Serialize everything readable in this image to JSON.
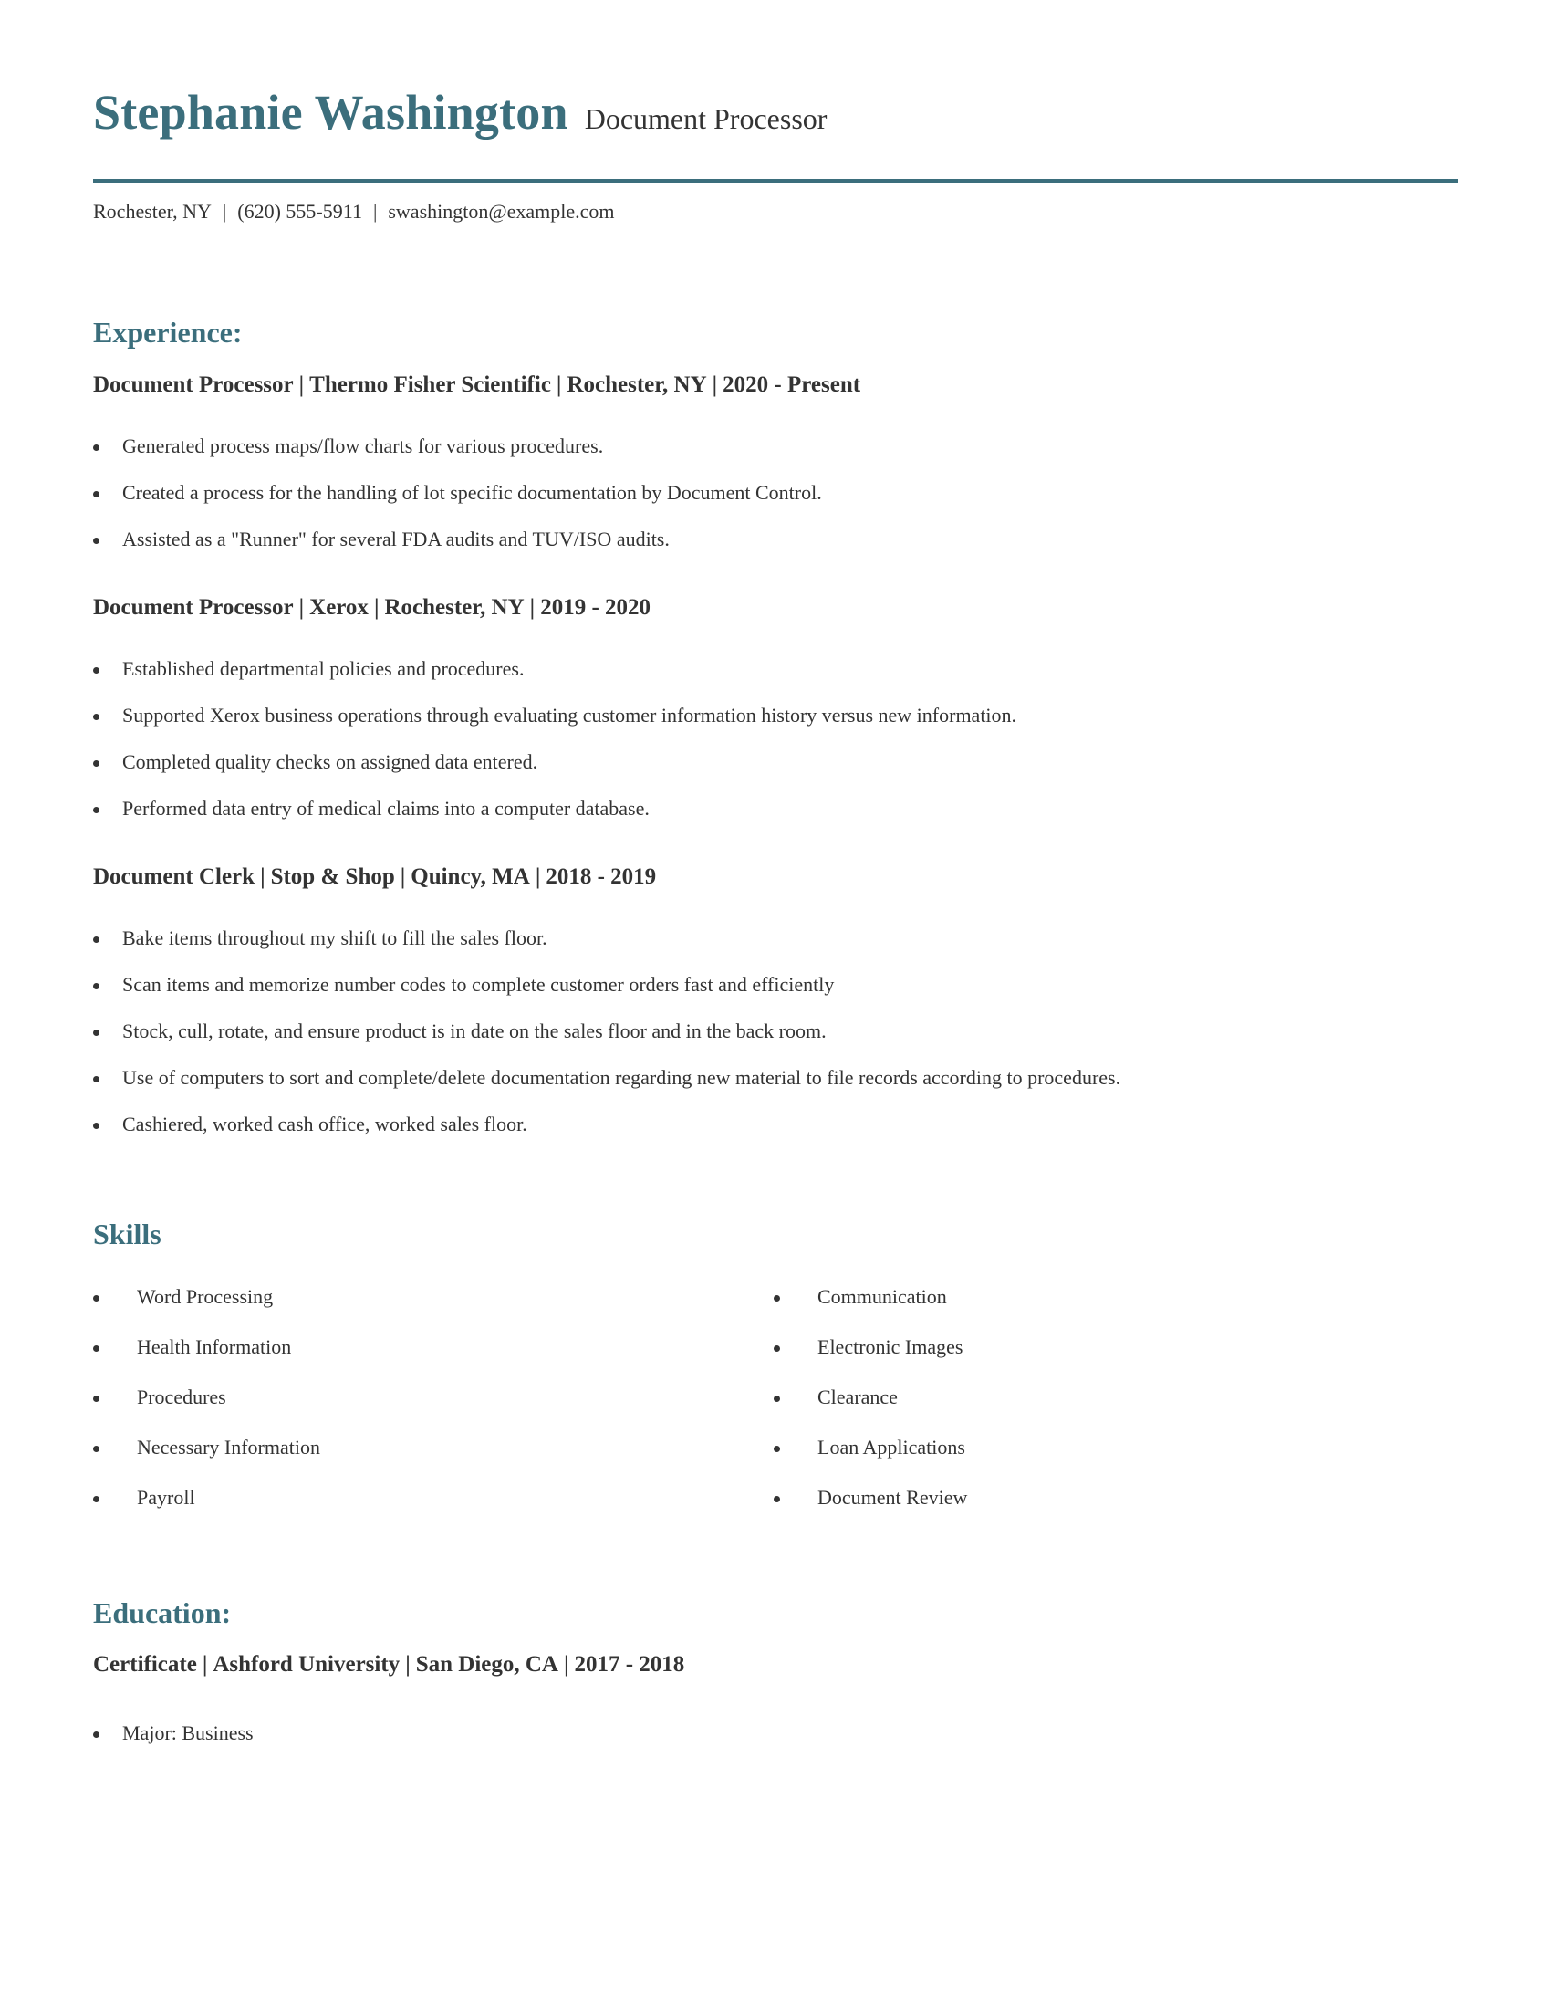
{
  "header": {
    "name": "Stephanie Washington",
    "role": "Document Processor",
    "contact": {
      "location": "Rochester, NY",
      "phone": "(620) 555-5911",
      "email": "swashington@example.com",
      "separator": "|"
    },
    "accent_color": "#3b6e7c"
  },
  "experience": {
    "title": "Experience:",
    "jobs": [
      {
        "role": "Document Processor",
        "company": "Thermo Fisher Scientific",
        "location": "Rochester, NY",
        "dates": "2020 - Present",
        "bullets": [
          "Generated process maps/flow charts for various procedures.",
          "Created a process for the handling of lot specific documentation by Document Control.",
          "Assisted as a \"Runner\" for several FDA audits and TUV/ISO audits."
        ]
      },
      {
        "role": "Document Processor",
        "company": "Xerox",
        "location": "Rochester, NY",
        "dates": "2019 - 2020",
        "bullets": [
          "Established departmental policies and procedures.",
          "Supported Xerox business operations through evaluating customer information history versus new information.",
          "Completed quality checks on assigned data entered.",
          "Performed data entry of medical claims into a computer database."
        ]
      },
      {
        "role": "Document Clerk",
        "company": "Stop & Shop",
        "location": "Quincy, MA",
        "dates": "2018 - 2019",
        "bullets": [
          "Bake items throughout my shift to fill the sales floor.",
          "Scan items and memorize number codes to complete customer orders fast and efficiently",
          "Stock, cull, rotate, and ensure product is in date on the sales floor and in the back room.",
          "Use of computers to sort and complete/delete documentation regarding new material to file records according to procedures.",
          "Cashiered, worked cash office, worked sales floor."
        ]
      }
    ]
  },
  "skills": {
    "title": "Skills",
    "left": [
      "Word Processing",
      "Health Information",
      "Procedures",
      "Necessary Information",
      "Payroll"
    ],
    "right": [
      "Communication",
      "Electronic Images",
      "Clearance",
      "Loan Applications",
      "Document Review"
    ]
  },
  "education": {
    "title": "Education:",
    "entries": [
      {
        "degree": "Certificate",
        "school": "Ashford University",
        "location": "San Diego, CA",
        "dates": "2017 - 2018",
        "bullets": [
          "Major: Business"
        ]
      }
    ]
  }
}
